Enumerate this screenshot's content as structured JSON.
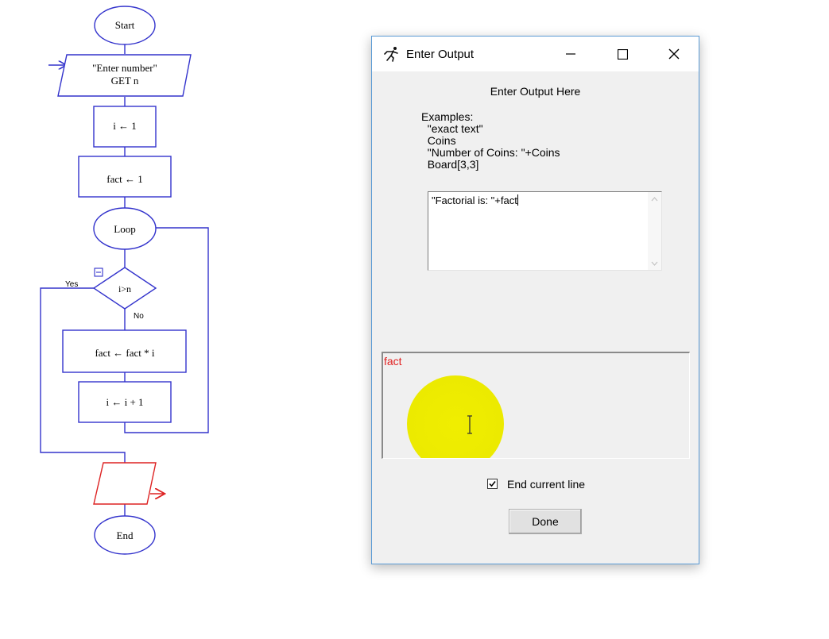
{
  "flowchart": {
    "start_label": "Start",
    "input_line1": "\"Enter number\"",
    "input_line2": "GET n",
    "assign_i": "i ← 1",
    "assign_fact": "fact ← 1",
    "loop_label": "Loop",
    "decision_label": "i>n",
    "yes_label": "Yes",
    "no_label": "No",
    "multiply_label": "fact ← fact * i",
    "increment_label": "i ← i + 1",
    "end_label": "End",
    "colors": {
      "shape": "#3333cc",
      "selected_output": "#dd2222"
    }
  },
  "dialog": {
    "title": "Enter Output",
    "heading": "Enter Output Here",
    "examples_title": "Examples:",
    "examples": [
      "  \"exact text\"",
      "  Coins",
      "  \"Number of Coins: \"+Coins",
      "  Board[3,3]"
    ],
    "output_value": "\"Factorial is: \"+fact",
    "variable_label": "fact",
    "checkbox_label": "End current line",
    "checkbox_checked": true,
    "done_label": "Done",
    "icons": {
      "app": "runner-icon",
      "minimize": "minimize-icon",
      "maximize": "maximize-icon",
      "close": "close-icon"
    }
  }
}
